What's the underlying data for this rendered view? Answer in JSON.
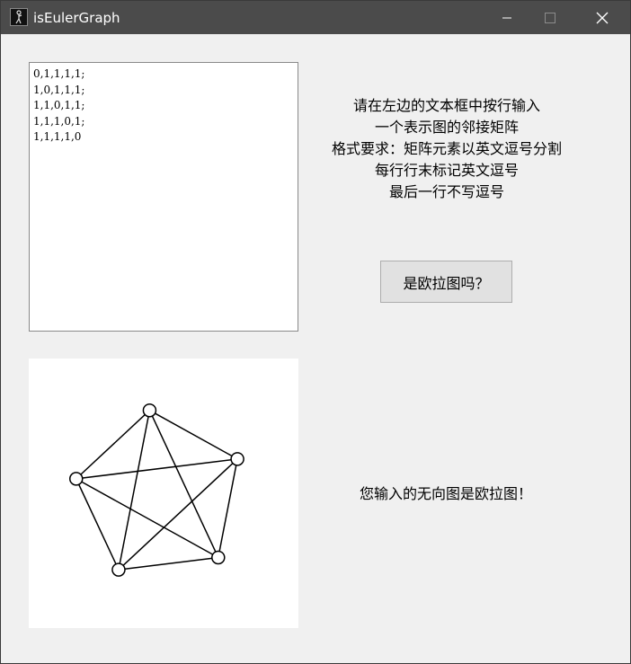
{
  "window": {
    "title": "isEulerGraph",
    "controls": [
      "minimize",
      "maximize",
      "close"
    ]
  },
  "matrix_input": {
    "lines": [
      "0,1,1,1,1;",
      "1,0,1,1,1;",
      "1,1,0,1,1;",
      "1,1,1,0,1;",
      "1,1,1,1,0"
    ]
  },
  "instructions": {
    "lines": [
      "请在左边的文本框中按行输入",
      "一个表示图的邻接矩阵",
      "格式要求：矩阵元素以英文逗号分割",
      "每行行末标记英文逗号",
      "最后一行不写逗号"
    ]
  },
  "check_button": {
    "label": "是欧拉图吗？"
  },
  "graph": {
    "vertex_count": 5,
    "edges": [
      [
        0,
        1
      ],
      [
        0,
        2
      ],
      [
        0,
        3
      ],
      [
        0,
        4
      ],
      [
        1,
        2
      ],
      [
        1,
        3
      ],
      [
        1,
        4
      ],
      [
        2,
        3
      ],
      [
        2,
        4
      ],
      [
        3,
        4
      ]
    ]
  },
  "result": {
    "text": "您输入的无向图是欧拉图！"
  }
}
